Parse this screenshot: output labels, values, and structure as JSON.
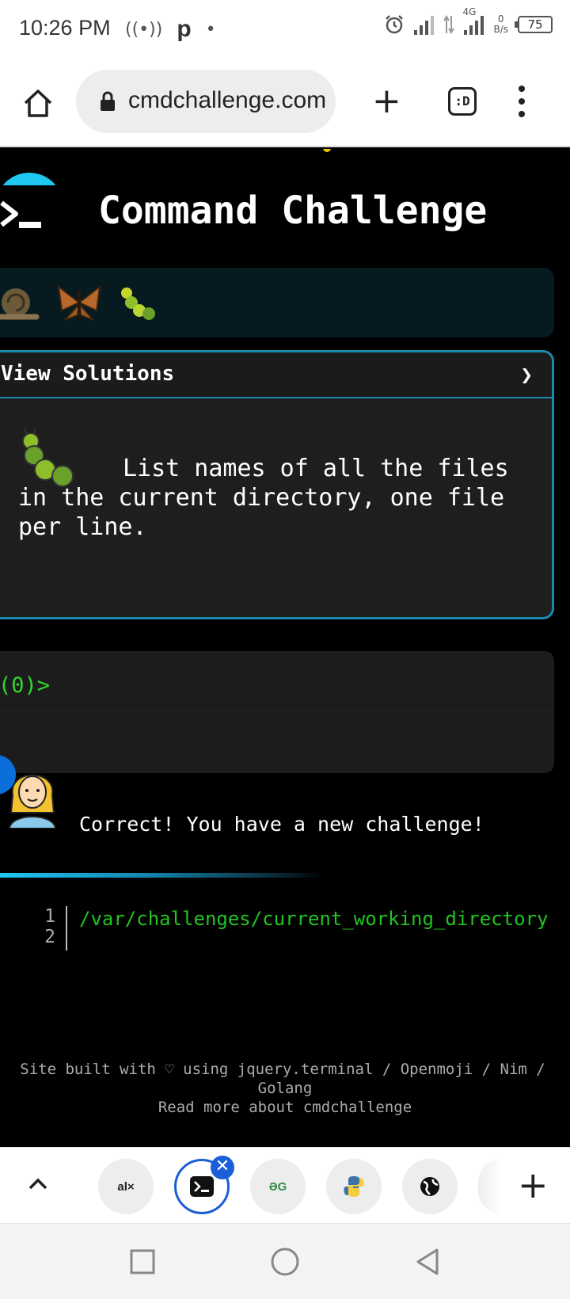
{
  "status_bar": {
    "time": "10:26 PM",
    "app_letter": "p",
    "net_speed_value": "0",
    "net_speed_unit": "B/s",
    "network_type": "4G",
    "battery": "75"
  },
  "browser": {
    "url": "cmdchallenge.com",
    "tabs_icon_label": ":D",
    "icons": [
      "home-icon",
      "lock-icon",
      "new-tab-icon",
      "tab-switcher-icon",
      "overflow-menu-icon"
    ]
  },
  "page": {
    "title": "Command Challenge",
    "badges": [
      "snail",
      "butterfly",
      "caterpillar"
    ],
    "challenge": {
      "header": "View Solutions",
      "chevron": "❯",
      "description": "List names of all the files in the current directory, one file per line."
    },
    "terminal": {
      "prompt": "(0)>"
    },
    "feedback": "Correct! You have a new challenge!",
    "editor": {
      "line_numbers": [
        "1",
        "2"
      ],
      "line1": "/var/challenges/current_working_directory"
    },
    "footer": {
      "line1": "Site built with ♡ using jquery.terminal / Openmoji / Nim /",
      "line2": "Golang",
      "line3": "Read more about cmdchallenge"
    }
  },
  "tab_strip": {
    "tabs": [
      {
        "label": "al×",
        "site": "alx"
      },
      {
        "label": "",
        "site": "cmdchallenge",
        "active": true
      },
      {
        "label": "ƏG",
        "site": "geeksforgeeks"
      },
      {
        "label": "",
        "site": "python"
      },
      {
        "label": "",
        "site": "web"
      }
    ],
    "close_icon": "✕"
  },
  "colors": {
    "accent_blue": "#1a8bb0",
    "terminal_green": "#22c322",
    "tab_active": "#1a5ed8"
  }
}
